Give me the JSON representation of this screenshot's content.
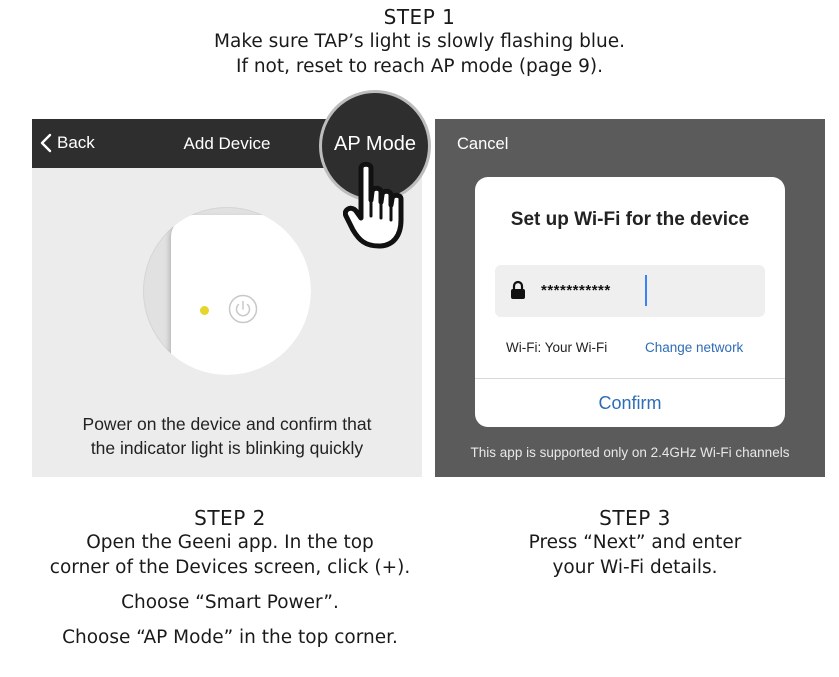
{
  "step1": {
    "title": "STEP 1",
    "line1": "Make sure TAP’s light is slowly flashing blue.",
    "line2": "If not, reset to reach AP mode (page 9)."
  },
  "left_screen": {
    "back_label": "Back",
    "title": "Add Device",
    "ap_mode_label": "AP Mode",
    "instruction_line1": "Power on the device and confirm that",
    "instruction_line2": "the indicator light is blinking quickly",
    "indicator_color": "#e6d52a",
    "nav_color": "#2e2e2e"
  },
  "right_screen": {
    "cancel_label": "Cancel",
    "dialog_title": "Set up Wi-Fi for the device",
    "password_value": "***********",
    "wifi_label": "Wi-Fi: Your Wi-Fi",
    "change_network_label": "Change network",
    "confirm_label": "Confirm",
    "support_note": "This app is supported only on 2.4GHz Wi-Fi channels",
    "accent_color": "#2d6db5"
  },
  "step2": {
    "title": "STEP 2",
    "line1": "Open the Geeni app. In the top",
    "line2": "corner of the Devices screen, click (+).",
    "line3": "Choose “Smart Power”.",
    "line4": "Choose “AP Mode” in the top corner."
  },
  "step3": {
    "title": "STEP 3",
    "line1": "Press “Next” and enter",
    "line2": "your Wi-Fi details."
  }
}
